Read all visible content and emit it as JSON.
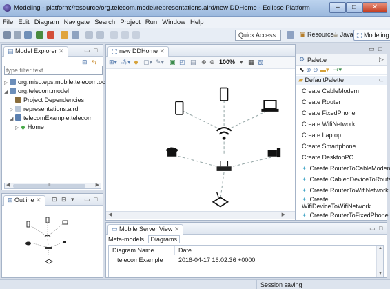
{
  "window": {
    "title": "Modeling - platform:/resource/org.telecom.model/representations.aird/new DDHome - Eclipse Platform"
  },
  "menu": [
    "File",
    "Edit",
    "Diagram",
    "Navigate",
    "Search",
    "Project",
    "Run",
    "Window",
    "Help"
  ],
  "toolbar": {
    "quick_access": "Quick Access",
    "perspectives": [
      "Resource",
      "Java",
      "Modeling"
    ]
  },
  "model_explorer": {
    "tab": "Model Explorer",
    "filter_placeholder": "type filter text",
    "tree": [
      {
        "label": "org.miso.eps.mobile.telecom.oc"
      },
      {
        "label": "org.telecom.model"
      },
      {
        "label": "Project Dependencies"
      },
      {
        "label": "representations.aird"
      },
      {
        "label": "telecomExample.telecom"
      },
      {
        "label": "Home"
      }
    ],
    "hscroll_label": "III"
  },
  "outline": {
    "tab": "Outline"
  },
  "editor": {
    "tab": "new DDHome",
    "zoom": "100%"
  },
  "palette": {
    "title": "Palette",
    "group": "DefaultPalette",
    "tools": [
      "Create CableModem",
      "Create Router",
      "Create FixedPhone",
      "Create WifiNetwork",
      "Create Laptop",
      "Create Smartphone",
      "Create DesktopPC"
    ],
    "connections": [
      "Create RouterToCableModem",
      "Create CabledDeviceToRouter",
      "Create RouterToWifiNetwork",
      "Create WifiDeviceToWifiNetwork",
      "Create RouterToFixedPhone"
    ]
  },
  "mobile_view": {
    "tab": "Mobile Server View",
    "tabs": [
      "Meta-models",
      "Diagrams"
    ],
    "columns": [
      "Diagram Name",
      "Date"
    ],
    "rows": [
      {
        "name": "telecomExample",
        "date": "2016-04-17 16:02:36 +0000"
      }
    ]
  },
  "status": {
    "text": "Session saving"
  },
  "colors": {
    "titlebar": "#a8c2e6",
    "close": "#c2391c",
    "palette_link": "#48a8c8"
  }
}
